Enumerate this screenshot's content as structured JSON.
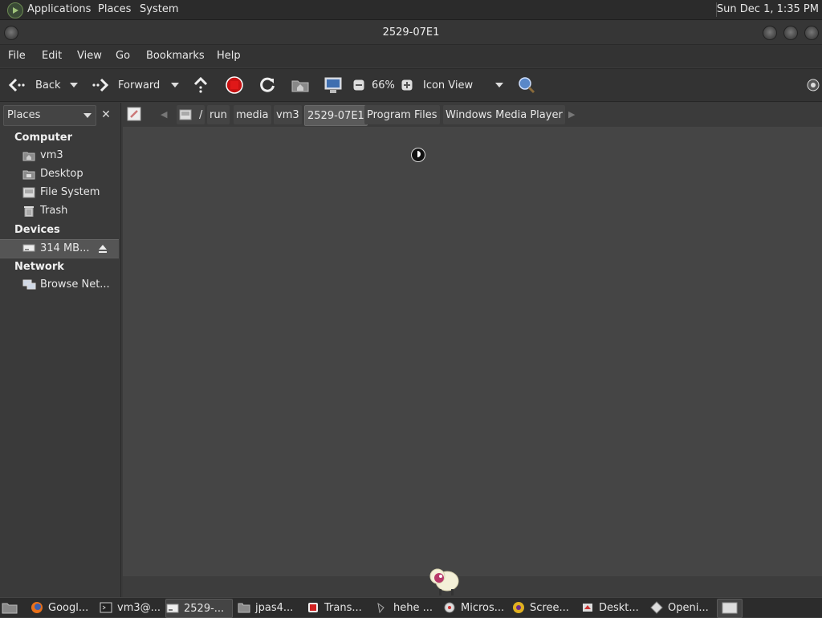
{
  "top_panel": {
    "menus": [
      "Applications",
      "Places",
      "System"
    ],
    "clock": "Sun Dec  1, 1:35 PM"
  },
  "window": {
    "title": "2529-07E1"
  },
  "menubar": [
    "File",
    "Edit",
    "View",
    "Go",
    "Bookmarks",
    "Help"
  ],
  "toolbar": {
    "back": "Back",
    "forward": "Forward",
    "zoom": "66%",
    "view_mode": "Icon View"
  },
  "location": {
    "root": "/",
    "crumbs": [
      "run",
      "media",
      "vm3",
      "2529-07E1",
      "Program Files",
      "Windows Media Player"
    ],
    "active_index": 3
  },
  "sidebar": {
    "selector": "Places",
    "computer_header": "Computer",
    "computer_items": [
      "vm3",
      "Desktop",
      "File System",
      "Trash"
    ],
    "devices_header": "Devices",
    "device_item": "314 MB...",
    "network_header": "Network",
    "network_item": "Browse Net..."
  },
  "taskbar": [
    "Googl...",
    "vm3@...",
    "2529-...",
    "jpas4...",
    "Trans...",
    "hehe ...",
    "Micros...",
    "Scree...",
    "Deskt...",
    "Openi..."
  ],
  "colors": {
    "background": "#3a3a3a",
    "content": "#454545",
    "stop_red": "#d01010",
    "accent_green": "#6c8a52"
  }
}
